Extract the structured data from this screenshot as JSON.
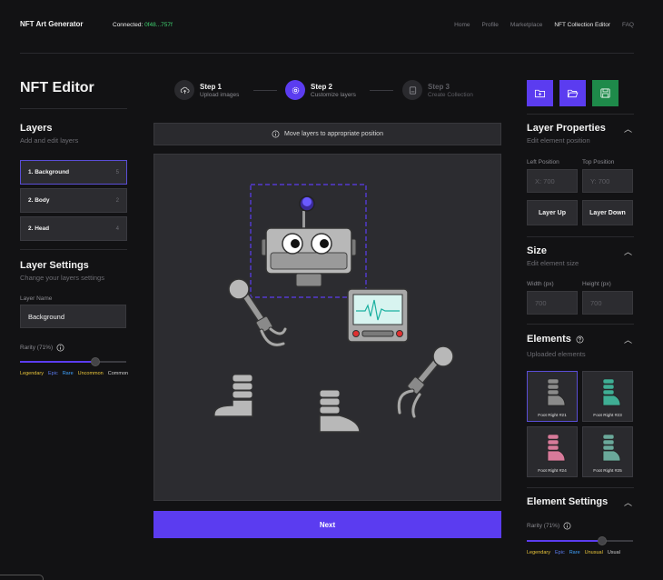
{
  "header": {
    "brand": "NFT Art Generator",
    "connected_label": "Connected:",
    "connected_address": "0f48...757f",
    "nav": [
      "Home",
      "Profile",
      "Marketplace",
      "NFT Collection Editor",
      "FAQ"
    ],
    "active_nav": "NFT Collection Editor"
  },
  "page_title": "NFT Editor",
  "steps": [
    {
      "title": "Step 1",
      "subtitle": "Upload images",
      "state": "done"
    },
    {
      "title": "Step 2",
      "subtitle": "Customize layers",
      "state": "active"
    },
    {
      "title": "Step 3",
      "subtitle": "Create Collection",
      "state": "pending"
    }
  ],
  "toolbar": {
    "icons": [
      "folder-plus-icon",
      "folder-open-icon",
      "save-icon"
    ],
    "accent": "#5b3cf0",
    "save_color": "#1e8a4a"
  },
  "layers": {
    "title": "Layers",
    "subtitle": "Add and edit layers",
    "items": [
      {
        "label": "1. Background",
        "count": "5"
      },
      {
        "label": "2. Body",
        "count": "2"
      },
      {
        "label": "2. Head",
        "count": "4"
      }
    ]
  },
  "layer_settings": {
    "title": "Layer Settings",
    "subtitle": "Change your layers settings",
    "name_label": "Layer Name",
    "name_value": "Background",
    "rarity_label": "Rarity (71%)",
    "rarity_value": 0.71,
    "tiers": [
      "Legendary",
      "Epic",
      "Rare",
      "Uncommon",
      "Common"
    ]
  },
  "canvas": {
    "info": "Move layers to appropriate position",
    "next_label": "Next"
  },
  "layer_properties": {
    "title": "Layer Properties",
    "subtitle": "Edit element position",
    "left_label": "Left Position",
    "left_placeholder": "X: 700",
    "top_label": "Top Position",
    "top_placeholder": "Y: 700",
    "up_label": "Layer Up",
    "down_label": "Layer Down"
  },
  "size": {
    "title": "Size",
    "subtitle": "Edit element size",
    "width_label": "Width (px)",
    "width_placeholder": "700",
    "height_label": "Height (px)",
    "height_placeholder": "700"
  },
  "elements": {
    "title": "Elements",
    "subtitle": "Uploaded elements",
    "items": [
      {
        "label": "Foot Right #21",
        "color": "#8a8a8a"
      },
      {
        "label": "Foot Right #23",
        "color": "#3fae94"
      },
      {
        "label": "Foot Right #24",
        "color": "#d77a9a"
      },
      {
        "label": "Foot Right #25",
        "color": "#6aa89a"
      }
    ]
  },
  "element_settings": {
    "title": "Element Settings",
    "rarity_label": "Rarity (71%)",
    "rarity_value": 0.71,
    "tiers": [
      "Legendary",
      "Epic",
      "Rare",
      "Unusual",
      "Usual"
    ]
  }
}
